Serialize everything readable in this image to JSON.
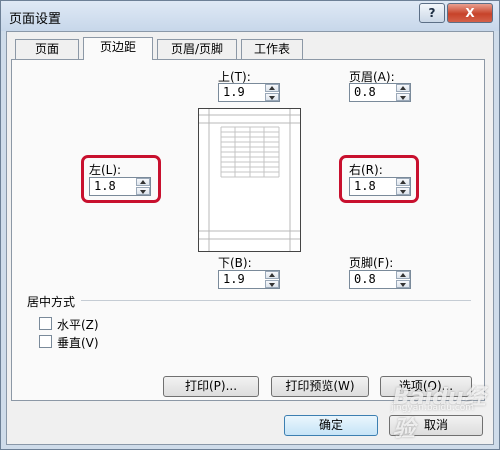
{
  "window": {
    "title": "页面设置",
    "help_label": "?",
    "close_label": "X"
  },
  "tabs": [
    {
      "label": "页面",
      "active": false
    },
    {
      "label": "页边距",
      "active": true
    },
    {
      "label": "页眉/页脚",
      "active": false
    },
    {
      "label": "工作表",
      "active": false
    }
  ],
  "margins": {
    "top": {
      "label": "上(T):",
      "value": "1.9"
    },
    "header": {
      "label": "页眉(A):",
      "value": "0.8"
    },
    "left": {
      "label": "左(L):",
      "value": "1.8"
    },
    "right": {
      "label": "右(R):",
      "value": "1.8"
    },
    "bottom": {
      "label": "下(B):",
      "value": "1.9"
    },
    "footer": {
      "label": "页脚(F):",
      "value": "0.8"
    }
  },
  "center": {
    "title": "居中方式",
    "horizontal": {
      "label": "水平(Z)",
      "checked": false
    },
    "vertical": {
      "label": "垂直(V)",
      "checked": false
    }
  },
  "buttons": {
    "print": "打印(P)...",
    "preview": "打印预览(W)",
    "options": "选项(O)...",
    "ok": "确定",
    "cancel": "取消"
  },
  "highlight_color": "#c8102e",
  "watermark": {
    "text": "Baidu经验",
    "sub": "jingyan.baidu.com"
  }
}
